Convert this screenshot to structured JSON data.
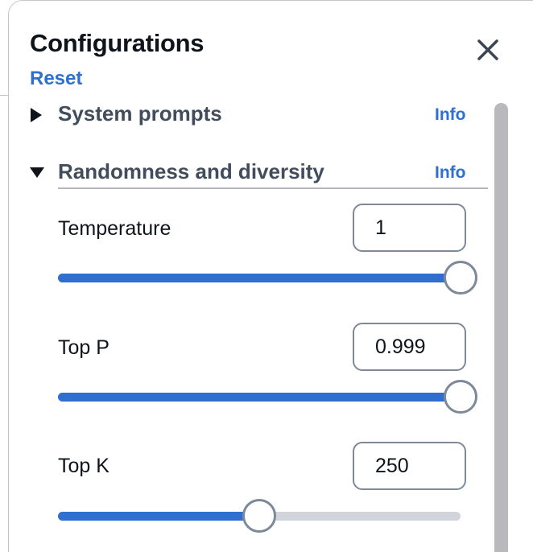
{
  "panel": {
    "title": "Configurations",
    "reset_label": "Reset",
    "close_icon": "close-icon"
  },
  "sections": [
    {
      "label": "System prompts",
      "expanded": false,
      "caret_icon": "caret-right-icon",
      "info_label": "Info"
    },
    {
      "label": "Randomness and diversity",
      "expanded": true,
      "caret_icon": "caret-down-icon",
      "info_label": "Info"
    }
  ],
  "params": [
    {
      "label": "Temperature",
      "value": "1",
      "slider_fraction": 1.0
    },
    {
      "label": "Top P",
      "value": "0.999",
      "slider_fraction": 1.0
    },
    {
      "label": "Top K",
      "value": "250",
      "slider_fraction": 0.5
    }
  ],
  "colors": {
    "accent": "#2f6fd1",
    "track": "#d1d5db",
    "border": "#7d8998"
  }
}
